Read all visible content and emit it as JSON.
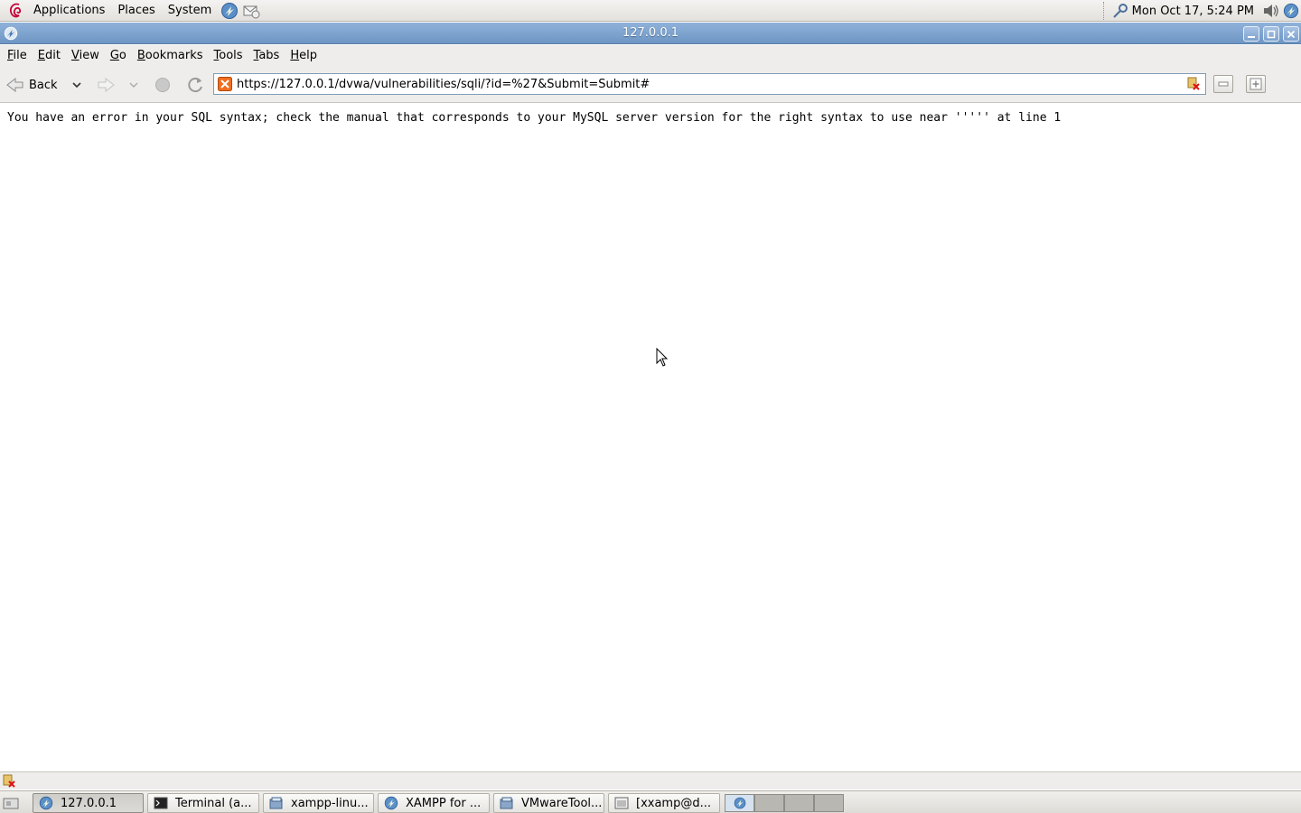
{
  "top_panel": {
    "menus": [
      "Applications",
      "Places",
      "System"
    ],
    "clock": "Mon Oct 17,  5:24 PM"
  },
  "window": {
    "title": "127.0.0.1"
  },
  "menubar": {
    "items": [
      {
        "mnemonic": "F",
        "rest": "ile"
      },
      {
        "mnemonic": "E",
        "rest": "dit"
      },
      {
        "mnemonic": "V",
        "rest": "iew"
      },
      {
        "mnemonic": "G",
        "rest": "o"
      },
      {
        "mnemonic": "B",
        "rest": "ookmarks"
      },
      {
        "mnemonic": "T",
        "rest": "ools"
      },
      {
        "mnemonic": "T",
        "rest": "abs"
      },
      {
        "mnemonic": "H",
        "rest": "elp"
      }
    ]
  },
  "navbar": {
    "back_label": "Back",
    "url": "https://127.0.0.1/dvwa/vulnerabilities/sqli/?id=%27&Submit=Submit#"
  },
  "content": {
    "error_message": "You have an error in your SQL syntax; check the manual that corresponds to your MySQL server version for the right syntax to use near ''''' at line 1"
  },
  "taskbar": {
    "tasks": [
      {
        "label": "127.0.0.1",
        "active": true
      },
      {
        "label": "Terminal (a...",
        "active": false
      },
      {
        "label": "xampp-linu...",
        "active": false
      },
      {
        "label": "XAMPP for ...",
        "active": false
      },
      {
        "label": "VMwareTool...",
        "active": false
      },
      {
        "label": "[xxamp@d...",
        "active": false
      }
    ]
  },
  "colors": {
    "titlebar": "#7ea2cf",
    "panel": "#e8e6e2"
  }
}
